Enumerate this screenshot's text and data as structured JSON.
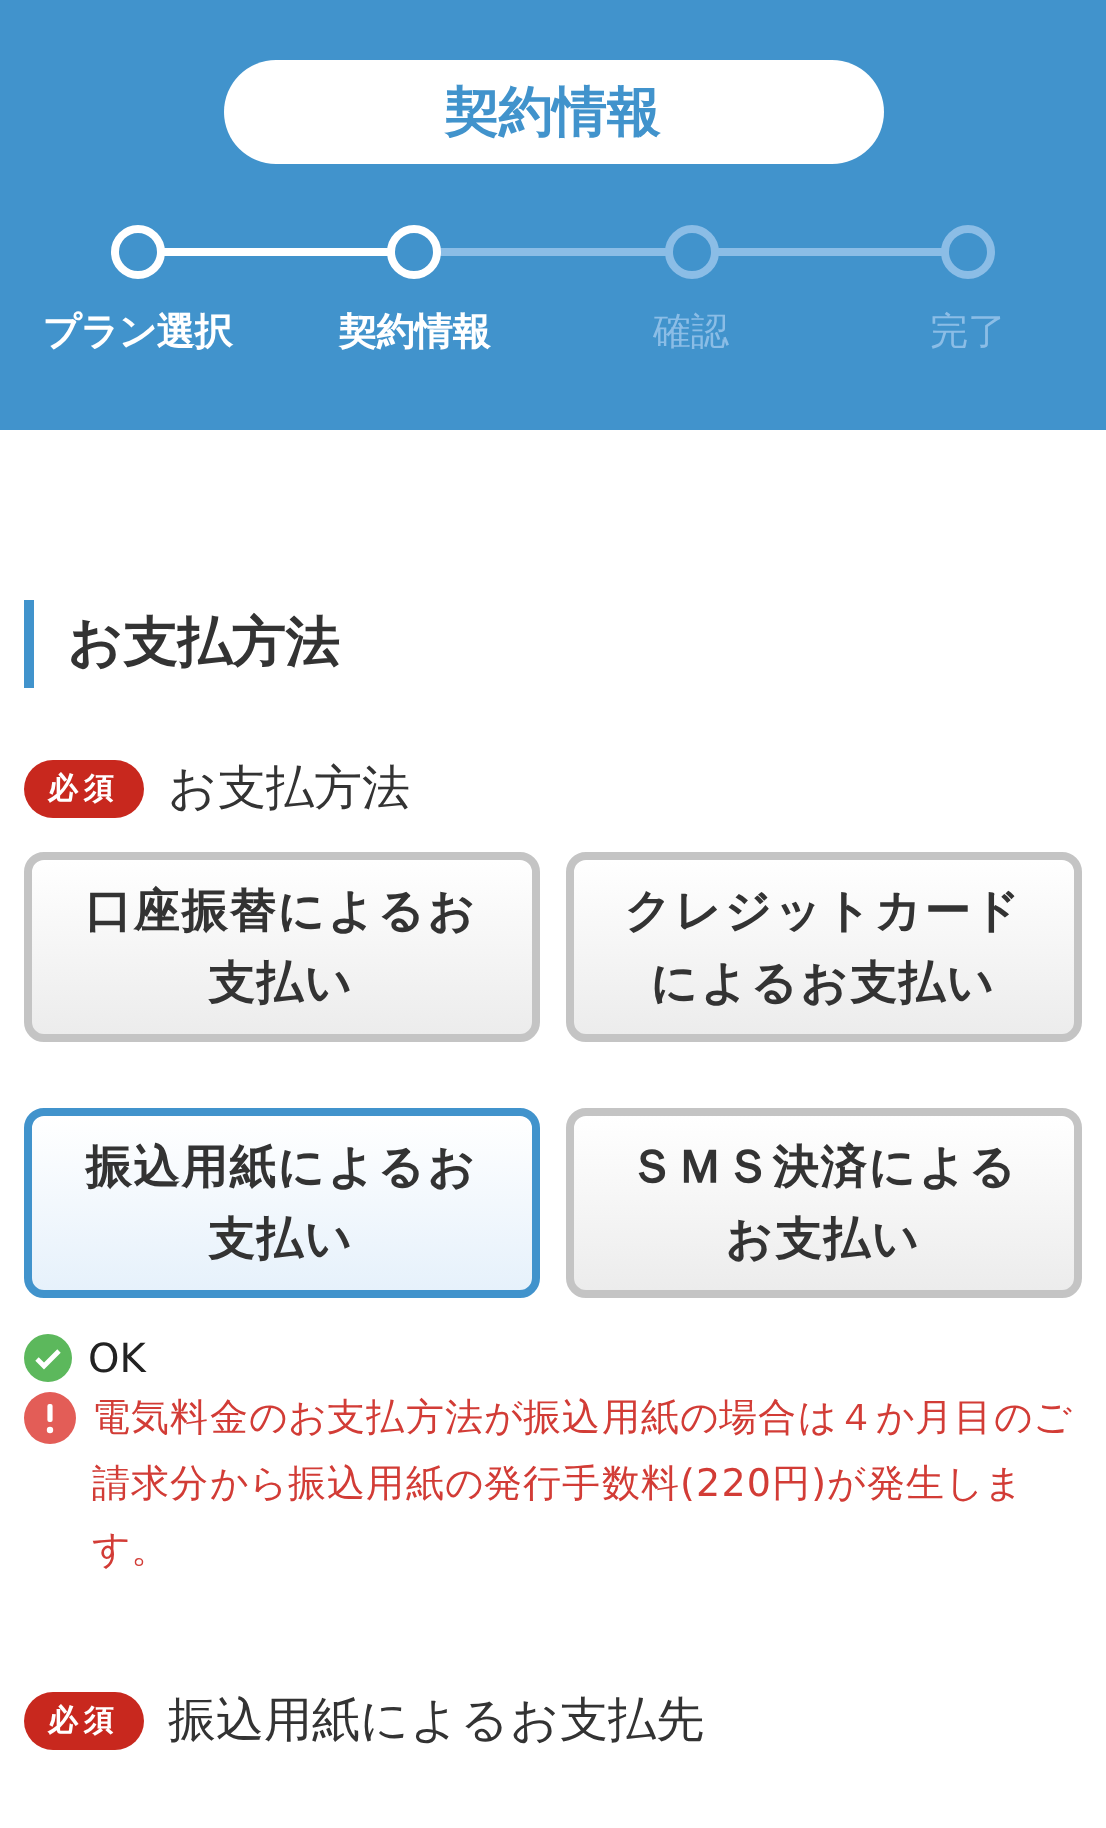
{
  "header": {
    "title": "契約情報",
    "steps": [
      {
        "label": "プラン選択",
        "reached": true
      },
      {
        "label": "契約情報",
        "reached": true
      },
      {
        "label": "確認",
        "reached": false
      },
      {
        "label": "完了",
        "reached": false
      }
    ]
  },
  "section": {
    "heading": "お支払方法",
    "fields": [
      {
        "badge": "必須",
        "label": "お支払方法"
      }
    ],
    "options": [
      {
        "label": "口座振替によるお支払い",
        "selected": false
      },
      {
        "label": "クレジットカードによるお支払い",
        "selected": false
      },
      {
        "label": "振込用紙によるお支払い",
        "selected": true
      },
      {
        "label": "ＳＭＳ決済によるお支払い",
        "selected": false
      }
    ],
    "status": "OK",
    "notice": "電気料金のお支払方法が振込用紙の場合は４か月目のご請求分から振込用紙の発行手数料(220円)が発生します。",
    "next_field": {
      "badge": "必須",
      "label": "振込用紙によるお支払先"
    }
  }
}
